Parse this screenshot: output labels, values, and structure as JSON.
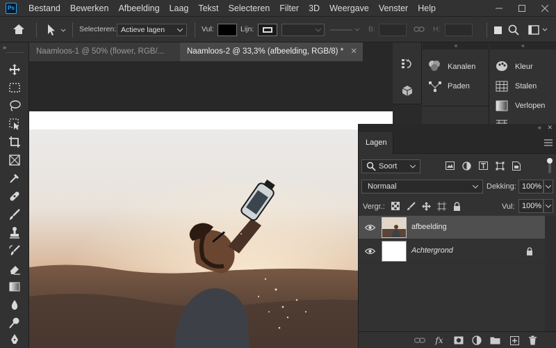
{
  "menubar": {
    "logo": "Ps",
    "items": [
      "Bestand",
      "Bewerken",
      "Afbeelding",
      "Laag",
      "Tekst",
      "Selecteren",
      "Filter",
      "3D",
      "Weergave",
      "Venster",
      "Help"
    ]
  },
  "options": {
    "select_label": "Selecteren:",
    "select_value": "Actieve lagen",
    "fill_label": "Vul:",
    "stroke_label": "Lijn:",
    "b_label": "B:",
    "h_label": "H:"
  },
  "tabs": [
    {
      "label": "Naamloos-1 @ 50% (flower, RGB/..."
    },
    {
      "label": "Naamloos-2 @ 33,3% (afbeelding, RGB/8) *"
    }
  ],
  "panels": {
    "kanalen": "Kanalen",
    "paden": "Paden",
    "kleur": "Kleur",
    "stalen": "Stalen",
    "verlopen": "Verlopen"
  },
  "layers_panel": {
    "title": "Lagen",
    "filter": "Soort",
    "blend_mode": "Normaal",
    "opacity_label": "Dekking:",
    "opacity_value": "100%",
    "lock_label": "Vergr.:",
    "fill_label": "Vul:",
    "fill_value": "100%",
    "layers": [
      {
        "name": "afbeelding",
        "selected": true
      },
      {
        "name": "Achtergrond",
        "locked": true
      }
    ]
  },
  "colors": {
    "accent": "#2fa3f7",
    "selected_layer": "#4f4f4f"
  }
}
